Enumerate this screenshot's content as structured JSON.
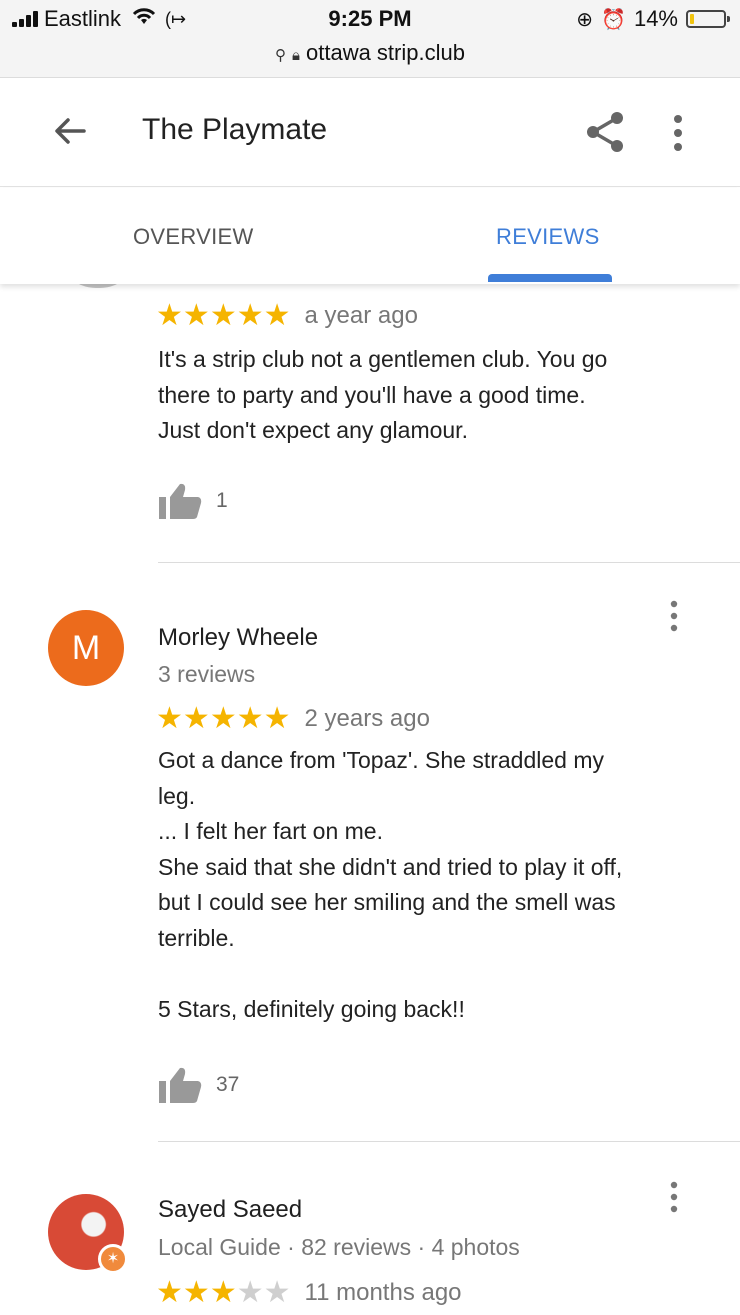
{
  "status_bar": {
    "carrier": "Eastlink",
    "time": "9:25 PM",
    "battery_percent": "14%",
    "battery_level": 0.14,
    "url": "ottawa strip.club"
  },
  "header": {
    "title": "The Playmate"
  },
  "tabs": [
    {
      "label": "OVERVIEW",
      "active": false
    },
    {
      "label": "REVIEWS",
      "active": true
    }
  ],
  "reviews": [
    {
      "name": "",
      "rating": 5,
      "time_ago": "a year ago",
      "lines": [
        "It's a strip club not a gentlemen club. You go",
        "there to party and you'll have a good time.",
        "Just don't expect any glamour."
      ],
      "likes": "1"
    },
    {
      "name": "Morley Wheele",
      "avatar_letter": "M",
      "meta": "3 reviews",
      "rating": 5,
      "time_ago": "2 years ago",
      "lines": [
        "Got a dance from 'Topaz'. She straddled my",
        "leg.",
        "... I felt her fart on me.",
        "She said that she didn't and tried to play it off,",
        "but I could see her smiling and the smell was",
        "terrible.",
        "",
        "5 Stars, definitely going back!!"
      ],
      "likes": "37"
    },
    {
      "name": "Sayed Saeed",
      "meta": "Local Guide · 82 reviews · 4 photos",
      "rating": 3,
      "time_ago": "11 months ago"
    }
  ],
  "colors": {
    "accent": "#3f7ed8",
    "star": "#f5b400",
    "avatar_orange": "#ec6b1c"
  },
  "icons": [
    "signal-icon",
    "wifi-icon",
    "hotspot-icon",
    "lock-icon",
    "search-icon",
    "orientation-lock-icon",
    "alarm-icon",
    "battery-icon",
    "back-arrow-icon",
    "share-icon",
    "more-vert-icon",
    "thumbs-up-icon",
    "local-guide-badge-icon"
  ]
}
